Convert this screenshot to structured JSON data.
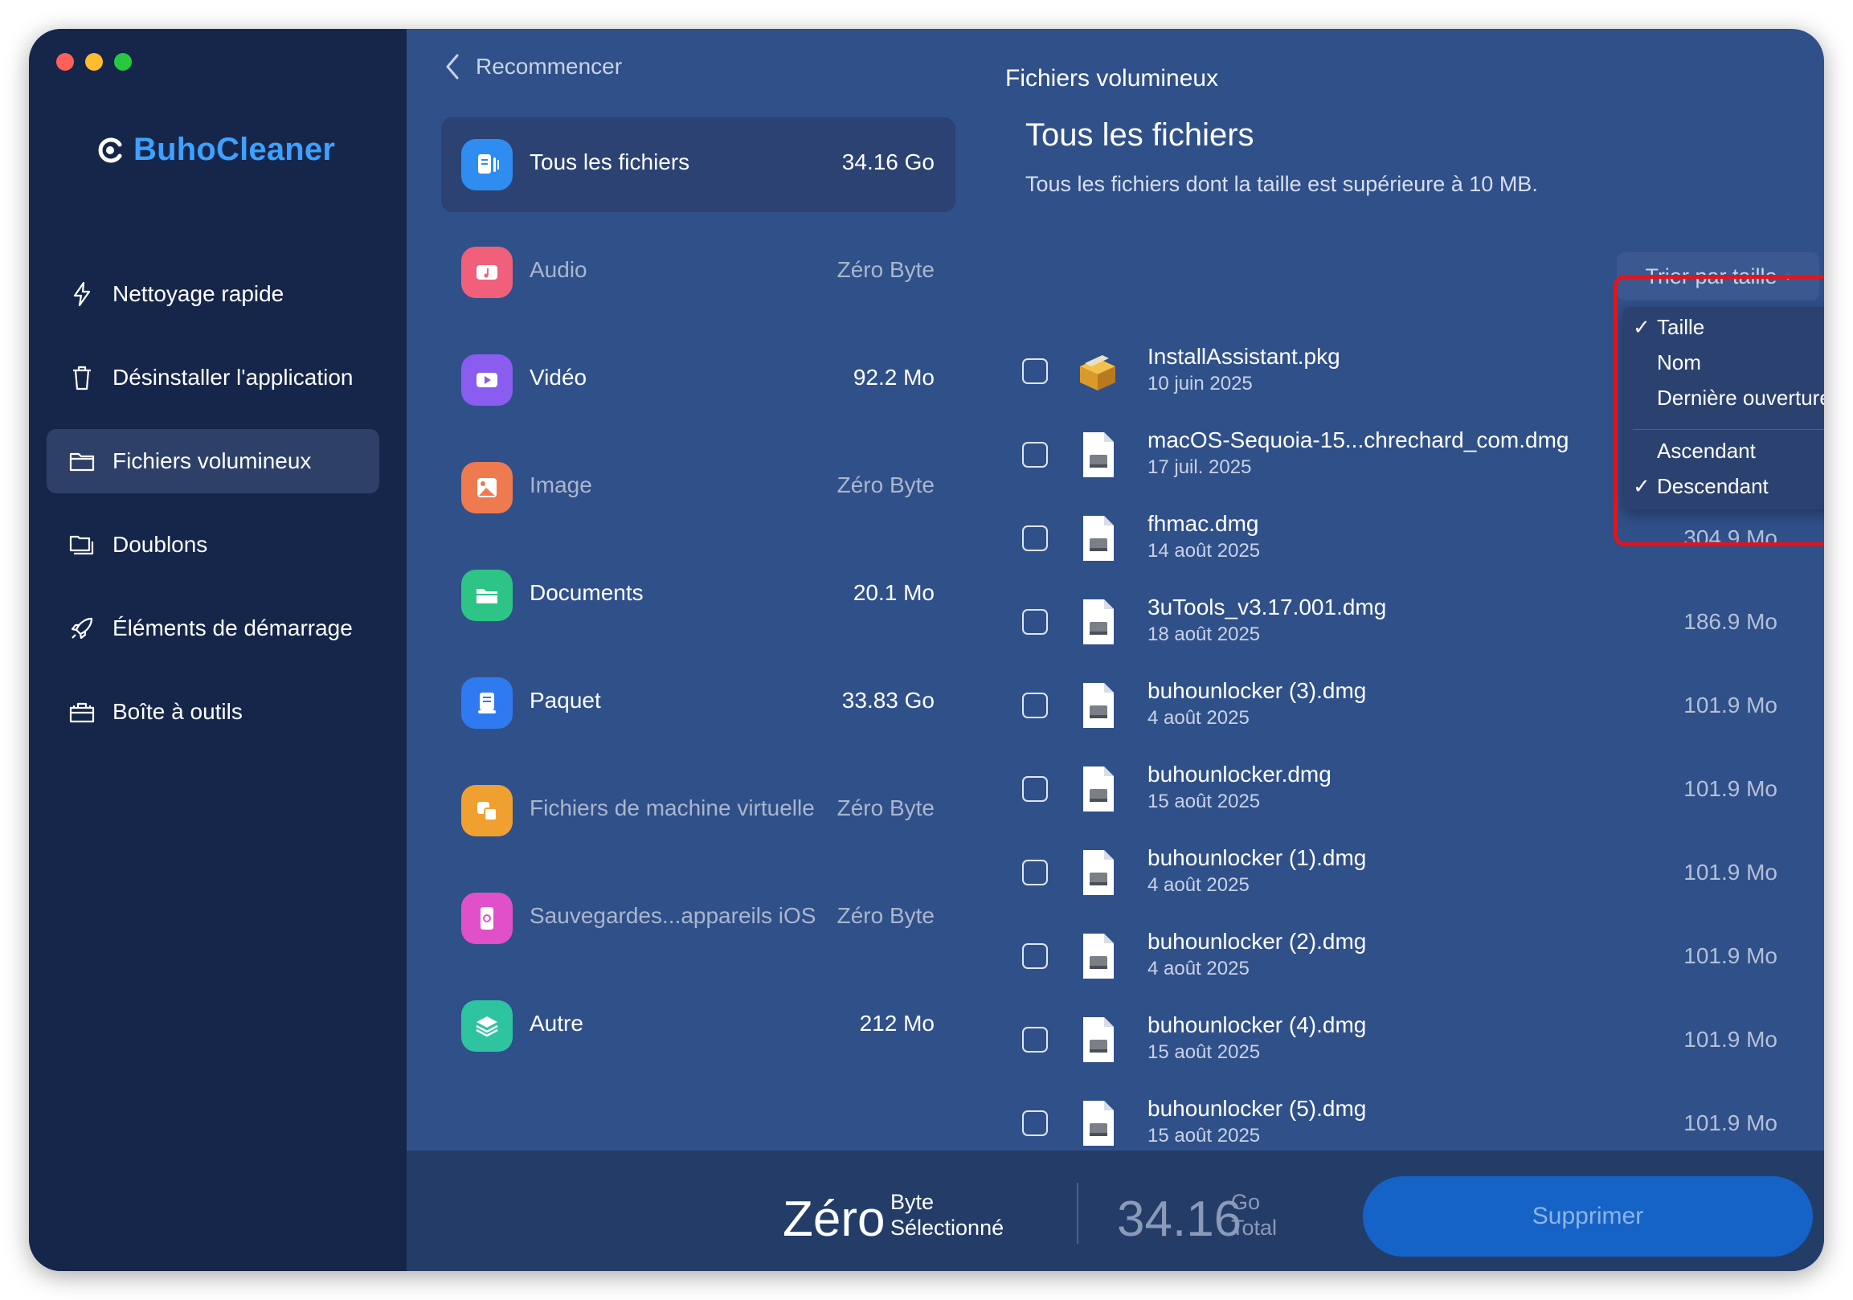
{
  "brand": {
    "name": "BuhoCleaner"
  },
  "sidebar": {
    "items": [
      {
        "label": "Nettoyage rapide",
        "icon": "bolt-icon"
      },
      {
        "label": "Désinstaller l'application",
        "icon": "trash-icon"
      },
      {
        "label": "Fichiers volumineux",
        "icon": "folder-icon",
        "active": true
      },
      {
        "label": "Doublons",
        "icon": "folders-icon"
      },
      {
        "label": "Éléments de démarrage",
        "icon": "rocket-icon"
      },
      {
        "label": "Boîte à outils",
        "icon": "toolbox-icon"
      }
    ]
  },
  "topbar": {
    "back_label": "Recommencer",
    "title": "Fichiers volumineux"
  },
  "categories": [
    {
      "label": "Tous les fichiers",
      "size": "34.16 Go",
      "color": "#2f8cf0",
      "icon": "files-icon",
      "active": true
    },
    {
      "label": "Audio",
      "size": "Zéro Byte",
      "color": "#f0607a",
      "icon": "music-icon",
      "dim": true
    },
    {
      "label": "Vidéo",
      "size": "92.2 Mo",
      "color": "#8a5cf0",
      "icon": "video-icon"
    },
    {
      "label": "Image",
      "size": "Zéro Byte",
      "color": "#f07a50",
      "icon": "image-icon",
      "dim": true
    },
    {
      "label": "Documents",
      "size": "20.1 Mo",
      "color": "#2ec486",
      "icon": "folder-icon"
    },
    {
      "label": "Paquet",
      "size": "33.83 Go",
      "color": "#2f7af0",
      "icon": "package-icon"
    },
    {
      "label": "Fichiers de machine virtuelle",
      "size": "Zéro Byte",
      "color": "#f0a030",
      "icon": "vm-icon",
      "dim": true
    },
    {
      "label": "Sauvegardes...appareils iOS",
      "size": "Zéro Byte",
      "color": "#e050c8",
      "icon": "phone-icon",
      "dim": true
    },
    {
      "label": "Autre",
      "size": "212 Mo",
      "color": "#2ec4a0",
      "icon": "layers-icon"
    }
  ],
  "panel": {
    "title": "Tous les fichiers",
    "subtitle": "Tous les fichiers dont la taille est supérieure à 10 MB.",
    "sort_label": "Trier par taille"
  },
  "sort_menu": {
    "items": [
      {
        "label": "Taille",
        "checked": true
      },
      {
        "label": "Nom",
        "checked": false
      },
      {
        "label": "Dernière ouverture",
        "checked": false
      },
      {
        "label": "Ascendant",
        "checked": false
      },
      {
        "label": "Descendant",
        "checked": true
      }
    ]
  },
  "files": [
    {
      "name": "InstallAssistant.pkg",
      "date": "10 juin 2025",
      "size": "",
      "icon": "package-box-icon"
    },
    {
      "name": "macOS-Sequoia-15...chrechard_com.dmg",
      "date": "17 juil. 2025",
      "size": "",
      "icon": "dmg-icon"
    },
    {
      "name": "fhmac.dmg",
      "date": "14 août 2025",
      "size": "304.9 Mo",
      "icon": "dmg-icon"
    },
    {
      "name": "3uTools_v3.17.001.dmg",
      "date": "18 août 2025",
      "size": "186.9 Mo",
      "icon": "dmg-icon"
    },
    {
      "name": "buhounlocker (3).dmg",
      "date": "4 août 2025",
      "size": "101.9 Mo",
      "icon": "dmg-icon"
    },
    {
      "name": "buhounlocker.dmg",
      "date": "15 août 2025",
      "size": "101.9 Mo",
      "icon": "dmg-icon"
    },
    {
      "name": "buhounlocker (1).dmg",
      "date": "4 août 2025",
      "size": "101.9 Mo",
      "icon": "dmg-icon"
    },
    {
      "name": "buhounlocker (2).dmg",
      "date": "4 août 2025",
      "size": "101.9 Mo",
      "icon": "dmg-icon"
    },
    {
      "name": "buhounlocker (4).dmg",
      "date": "15 août 2025",
      "size": "101.9 Mo",
      "icon": "dmg-icon"
    },
    {
      "name": "buhounlocker (5).dmg",
      "date": "15 août 2025",
      "size": "101.9 Mo",
      "icon": "dmg-icon"
    }
  ],
  "footer": {
    "selected_value": "Zéro",
    "selected_unit": "Byte",
    "selected_label": "Sélectionné",
    "total_value": "34.16",
    "total_unit": "Go",
    "total_label": "Total",
    "delete_label": "Supprimer"
  },
  "colors": {
    "accent": "#3ea0ff",
    "sidebar_bg": "#16264a",
    "main_bg": "#30508a",
    "highlight": "#e3141b"
  }
}
